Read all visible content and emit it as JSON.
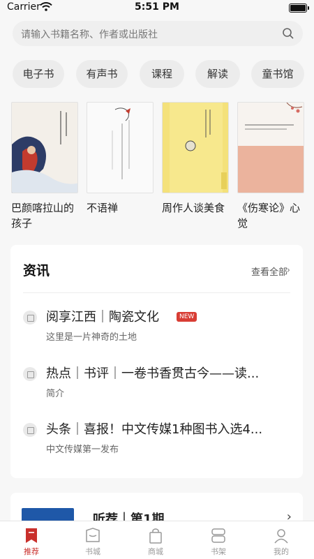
{
  "status_bar": {
    "carrier": "Carrier",
    "time": "5:51 PM"
  },
  "search": {
    "placeholder": "请输入书籍名称、作者或出版社",
    "icon": "search-icon"
  },
  "categories": [
    "电子书",
    "有声书",
    "课程",
    "解读",
    "童书馆"
  ],
  "books": [
    {
      "title": "巴颜喀拉山的孩子",
      "cover_text": "巴颜喀拉山的孩子"
    },
    {
      "title": "不语禅",
      "cover_text": "不语禅"
    },
    {
      "title": "周作人谈美食",
      "cover_text": "周作人谈美食"
    },
    {
      "title": "《伤寒论》心觉",
      "cover_text": "《伤寒论》心觉"
    }
  ],
  "news": {
    "heading": "资讯",
    "see_all": "查看全部",
    "items": [
      {
        "title": "阅享江西｜陶瓷文化",
        "subtitle": "这里是一片神奇的土地",
        "badge": "NEW"
      },
      {
        "title": "热点｜书评｜一卷书香贯古今——读...",
        "subtitle": "简介"
      },
      {
        "title": "头条｜喜报！中文传媒1种图书入选4...",
        "subtitle": "中文传媒第一发布"
      }
    ]
  },
  "listen": {
    "title": "听荐｜第1期"
  },
  "tabbar": [
    {
      "label": "推荐",
      "icon": "bookmark-icon",
      "active": true
    },
    {
      "label": "书城",
      "icon": "bookstore-icon"
    },
    {
      "label": "商城",
      "icon": "shopping-bag-icon"
    },
    {
      "label": "书架",
      "icon": "bookshelf-icon"
    },
    {
      "label": "我的",
      "icon": "user-icon"
    }
  ],
  "colors": {
    "accent": "#c9302c",
    "badge": "#d83d34",
    "background": "#f7f7f7"
  }
}
